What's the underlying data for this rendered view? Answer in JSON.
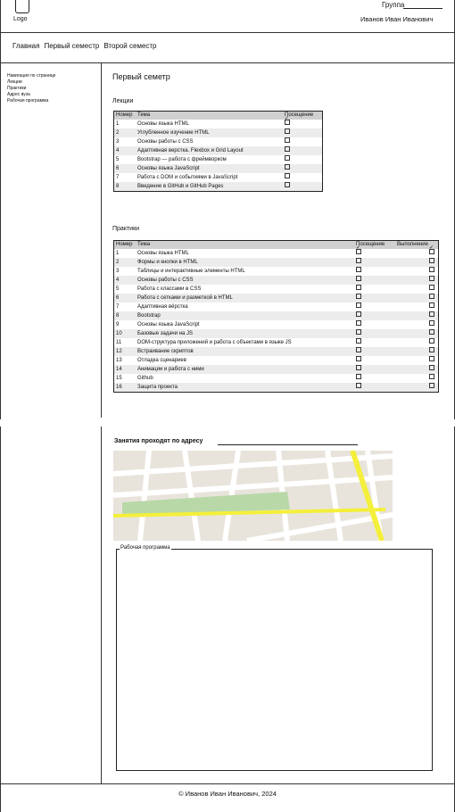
{
  "header": {
    "logo_label": "Logo",
    "group_label": "Группа",
    "user_name": "Иванов Иван Иванович"
  },
  "nav": {
    "items": [
      "Главная",
      "Первый семестр",
      "Второй семестр"
    ]
  },
  "sidebar": {
    "items": [
      "Навигация по странице",
      "Лекции",
      "Практики",
      "Адрес вуза",
      "Рабочая программа"
    ]
  },
  "main": {
    "title": "Первый семетр",
    "lectures": {
      "title": "Лекции",
      "headers": [
        "Номер",
        "Тема",
        "Посещение"
      ],
      "rows": [
        {
          "num": "1",
          "topic": "Основы языка HTML",
          "visited": true
        },
        {
          "num": "2",
          "topic": "Углубленное изучение HTML",
          "visited": false
        },
        {
          "num": "3",
          "topic": "Основы работы с CSS",
          "visited": false
        },
        {
          "num": "4",
          "topic": "Адаптивная верстка. Flexbox и Grid Layout",
          "visited": false
        },
        {
          "num": "5",
          "topic": "Bootstrap — работа с фреймворком",
          "visited": false
        },
        {
          "num": "6",
          "topic": "Основы языка JavaScript",
          "visited": false
        },
        {
          "num": "7",
          "topic": "Работа с DOM и событиями в JavaScript",
          "visited": false
        },
        {
          "num": "8",
          "topic": "Введение в GitHub и GitHub Pages",
          "visited": false
        }
      ]
    },
    "practices": {
      "title": "Практики",
      "headers": [
        "Номер",
        "Тема",
        "Посещение",
        "Выполнение"
      ],
      "rows": [
        {
          "num": "1",
          "topic": "Основы языка HTML",
          "visited": true,
          "done": true
        },
        {
          "num": "2",
          "topic": "Формы и кнопки в HTML",
          "visited": false,
          "done": false
        },
        {
          "num": "3",
          "topic": "Таблицы и интерактивные элементы HTML",
          "visited": false,
          "done": false
        },
        {
          "num": "4",
          "topic": " Основы работы с CSS",
          "visited": false,
          "done": false
        },
        {
          "num": "5",
          "topic": " Работа с классами в CSS",
          "visited": false,
          "done": false
        },
        {
          "num": "6",
          "topic": "Работа с сетками и разметкой в HTML",
          "visited": false,
          "done": false
        },
        {
          "num": "7",
          "topic": "Адаптивная вёрстка",
          "visited": false,
          "done": false
        },
        {
          "num": "8",
          "topic": "Bootstrap",
          "visited": false,
          "done": false
        },
        {
          "num": "9",
          "topic": "Основы языка JavaScript",
          "visited": false,
          "done": false
        },
        {
          "num": "10",
          "topic": "Базовые задачи на JS",
          "visited": false,
          "done": false
        },
        {
          "num": "11",
          "topic": "DOM-структура приложений и работа с объектами в языке JS",
          "visited": false,
          "done": false
        },
        {
          "num": "12",
          "topic": "Встраивание скриптов",
          "visited": false,
          "done": false
        },
        {
          "num": "13",
          "topic": "Отладка сценариев",
          "visited": false,
          "done": false
        },
        {
          "num": "14",
          "topic": " Анимации и работа с ними",
          "visited": false,
          "done": false
        },
        {
          "num": "15",
          "topic": "Github",
          "visited": false,
          "done": false
        },
        {
          "num": "16",
          "topic": "Защита проекта",
          "visited": false,
          "done": false
        }
      ]
    },
    "address_label": "Занятия проходят по адресу",
    "program_legend": "Рабочая программа"
  },
  "footer": {
    "copyright": "© Иванов Иван Иванович, 2024"
  },
  "colors": {
    "map_bg": "#e8e4dc",
    "map_road": "#ffffff",
    "map_yellow": "#f4ef3a",
    "map_green": "#b8d8a8"
  }
}
